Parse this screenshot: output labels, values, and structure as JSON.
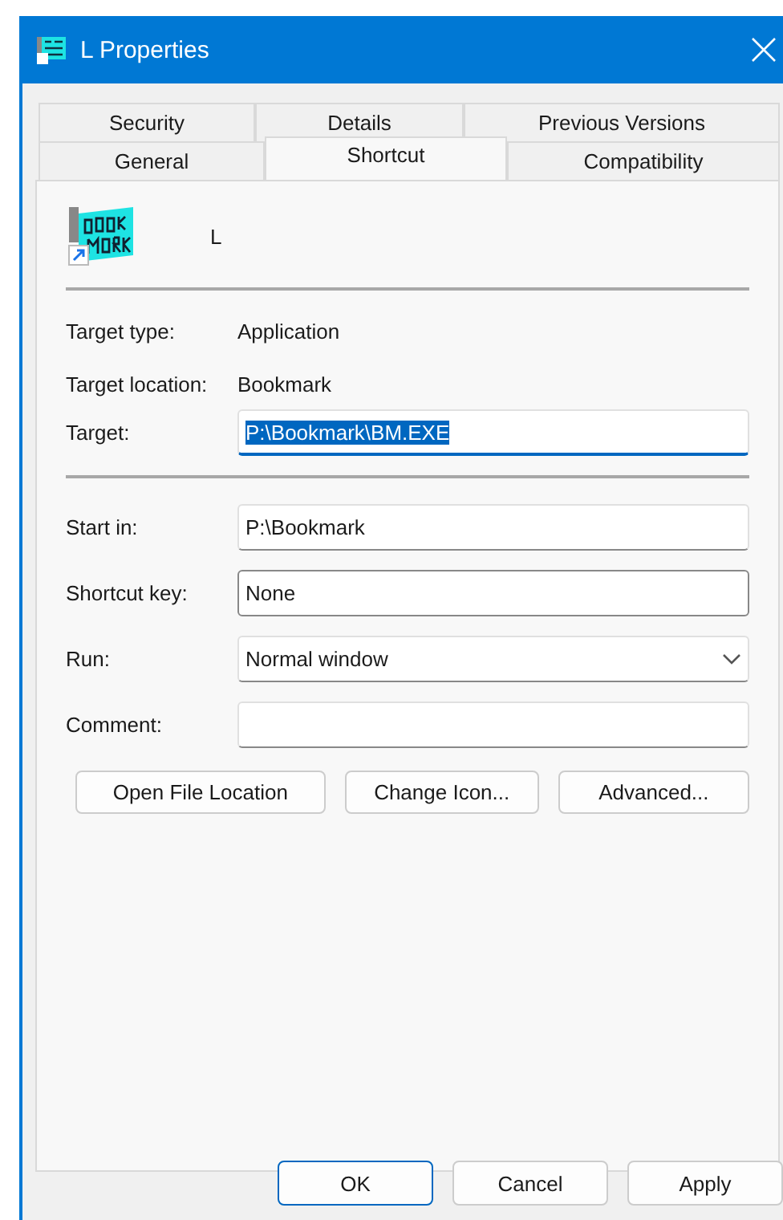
{
  "window": {
    "title": "L Properties"
  },
  "tabs": [
    [
      {
        "label": "Security",
        "selected": false
      },
      {
        "label": "Details",
        "selected": false
      },
      {
        "label": "Previous Versions",
        "selected": false
      }
    ],
    [
      {
        "label": "General",
        "selected": false
      },
      {
        "label": "Shortcut",
        "selected": true
      },
      {
        "label": "Compatibility",
        "selected": false
      }
    ]
  ],
  "shortcut_name": "L",
  "info": [
    {
      "label": "Target type:",
      "value": "Application"
    },
    {
      "label": "Target location:",
      "value": "Bookmark"
    }
  ],
  "target": {
    "label": "Target:",
    "value": "P:\\Bookmark\\BM.EXE",
    "focused": true,
    "text_selected": true
  },
  "fields": [
    {
      "label": "Start in:",
      "value": "P:\\Bookmark",
      "kind": "text"
    },
    {
      "label": "Shortcut key:",
      "value": "None",
      "kind": "hotkey"
    },
    {
      "label": "Run:",
      "value": "Normal window",
      "kind": "dropdown"
    },
    {
      "label": "Comment:",
      "kind": "text"
    }
  ],
  "actions": [
    {
      "label": "Open File Location"
    },
    {
      "label": "Change Icon..."
    },
    {
      "label": "Advanced..."
    }
  ],
  "dialog_buttons": [
    {
      "label": "OK",
      "default": true
    },
    {
      "label": "Cancel",
      "default": false
    },
    {
      "label": "Apply",
      "default": false
    }
  ]
}
